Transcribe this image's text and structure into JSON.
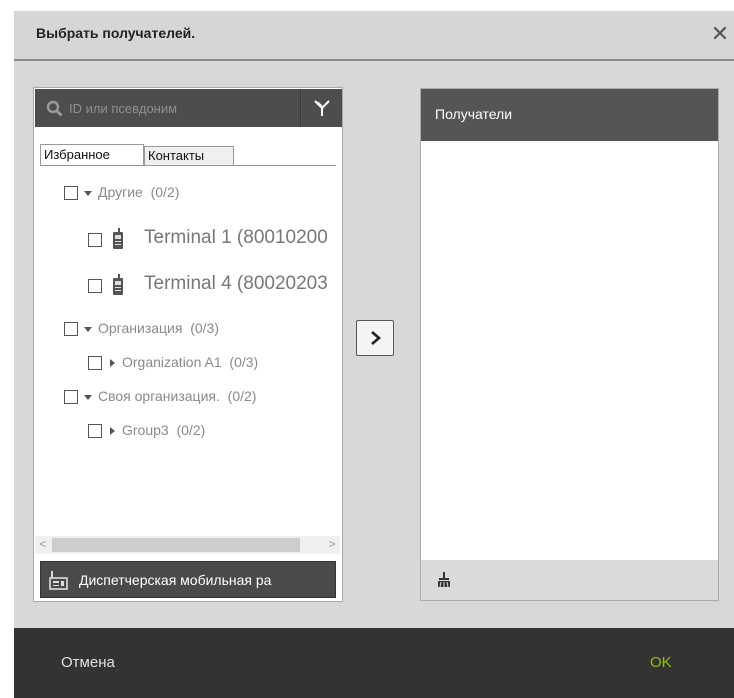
{
  "dialog": {
    "title": "Выбрать получателей.",
    "close_icon": "close-icon"
  },
  "search": {
    "placeholder": "ID или псевдоним",
    "value": "",
    "icon": "search-icon",
    "filter_icon": "filter-icon"
  },
  "tabs": [
    {
      "label": "Избранное",
      "active": true
    },
    {
      "label": "Контакты",
      "active": false
    }
  ],
  "tree": {
    "nodes": [
      {
        "label": "Другие",
        "count": "(0/2)",
        "expanded": true,
        "checked": false
      },
      {
        "label": "Terminal 1 (80010200",
        "icon": "radio-terminal-icon",
        "checked": false
      },
      {
        "label": "Terminal 4 (80020203",
        "icon": "radio-terminal-icon",
        "checked": false
      },
      {
        "label": "Организация",
        "count": "(0/3)",
        "expanded": true,
        "checked": false
      },
      {
        "label": "Organization A1",
        "count": "(0/3)",
        "expanded": false,
        "checked": false
      },
      {
        "label": "Своя организация.",
        "count": "(0/2)",
        "expanded": true,
        "checked": false
      },
      {
        "label": "Group3",
        "count": "(0/2)",
        "expanded": false,
        "checked": false
      }
    ]
  },
  "scroll": {
    "left": "<",
    "right": ">"
  },
  "dispatch_button": {
    "label": "Диспетчерская мобильная ра",
    "icon": "dispatch-radio-icon"
  },
  "move_button": {
    "icon": "chevron-right-icon"
  },
  "recipients": {
    "title": "Получатели",
    "clear_icon": "clear-broom-icon"
  },
  "footer": {
    "cancel": "Отмена",
    "ok": "OK"
  },
  "colors": {
    "ok": "#8cc800",
    "bottom_bar": "#333333",
    "header": "#555555"
  }
}
